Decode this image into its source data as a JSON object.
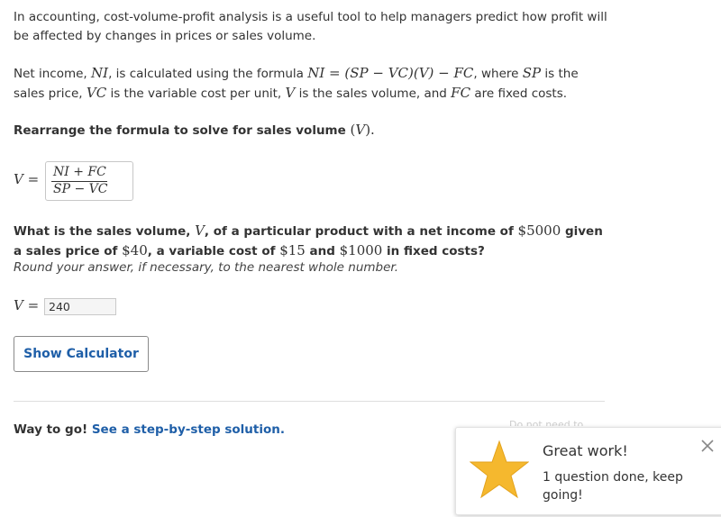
{
  "intro": {
    "text": "In accounting, cost-volume-profit analysis is a useful tool to help managers predict how profit will be affected by changes in prices or sales volume."
  },
  "net_income": {
    "prefix": "Net income, ",
    "ni_symbol": "NI",
    "mid1": ", is calculated using the formula ",
    "formula": "NI = (SP − VC)(V) − FC",
    "mid2": ", where ",
    "sp_symbol": "SP",
    "mid3": " is the sales price, ",
    "vc_symbol": "VC",
    "mid4": " is the variable cost per unit, ",
    "v_symbol": "V",
    "mid5": " is the sales volume, and ",
    "fc_symbol": "FC",
    "suffix": " are fixed costs."
  },
  "rearrange": {
    "text": "Rearrange the formula to solve for sales volume ",
    "paren_open": "(",
    "v_symbol": "V",
    "paren_close": ")."
  },
  "equation": {
    "label_var": "V",
    "label_eq": " =",
    "numerator": "NI + FC",
    "denominator": "SP − VC"
  },
  "question": {
    "t1": "What is the sales volume, ",
    "v_symbol": "V",
    "t2": ", of a particular product with a net income of ",
    "net_income": "$5000",
    "t3": " given a sales price of ",
    "sales_price": "$40",
    "t4": ", a variable cost of ",
    "variable_cost": "$15",
    "t5": " and ",
    "fixed_costs": "$1000",
    "t6": " in fixed costs?",
    "hint": "Round your answer, if necessary, to the nearest whole number."
  },
  "answer": {
    "label_var": "V",
    "label_eq": " =",
    "value": "240"
  },
  "calculator_button": {
    "label": "Show Calculator"
  },
  "feedback": {
    "text": "Way to go! ",
    "link": "See a step-by-step solution."
  },
  "background_hint": {
    "text": "Do not need to"
  },
  "toast": {
    "title": "Great work!",
    "message": "1 question done, keep going!",
    "icon": "star-icon",
    "close_icon": "close-icon",
    "star_color": "#f5b82e"
  },
  "colors": {
    "link": "#1f5fa8",
    "text": "#333333"
  }
}
